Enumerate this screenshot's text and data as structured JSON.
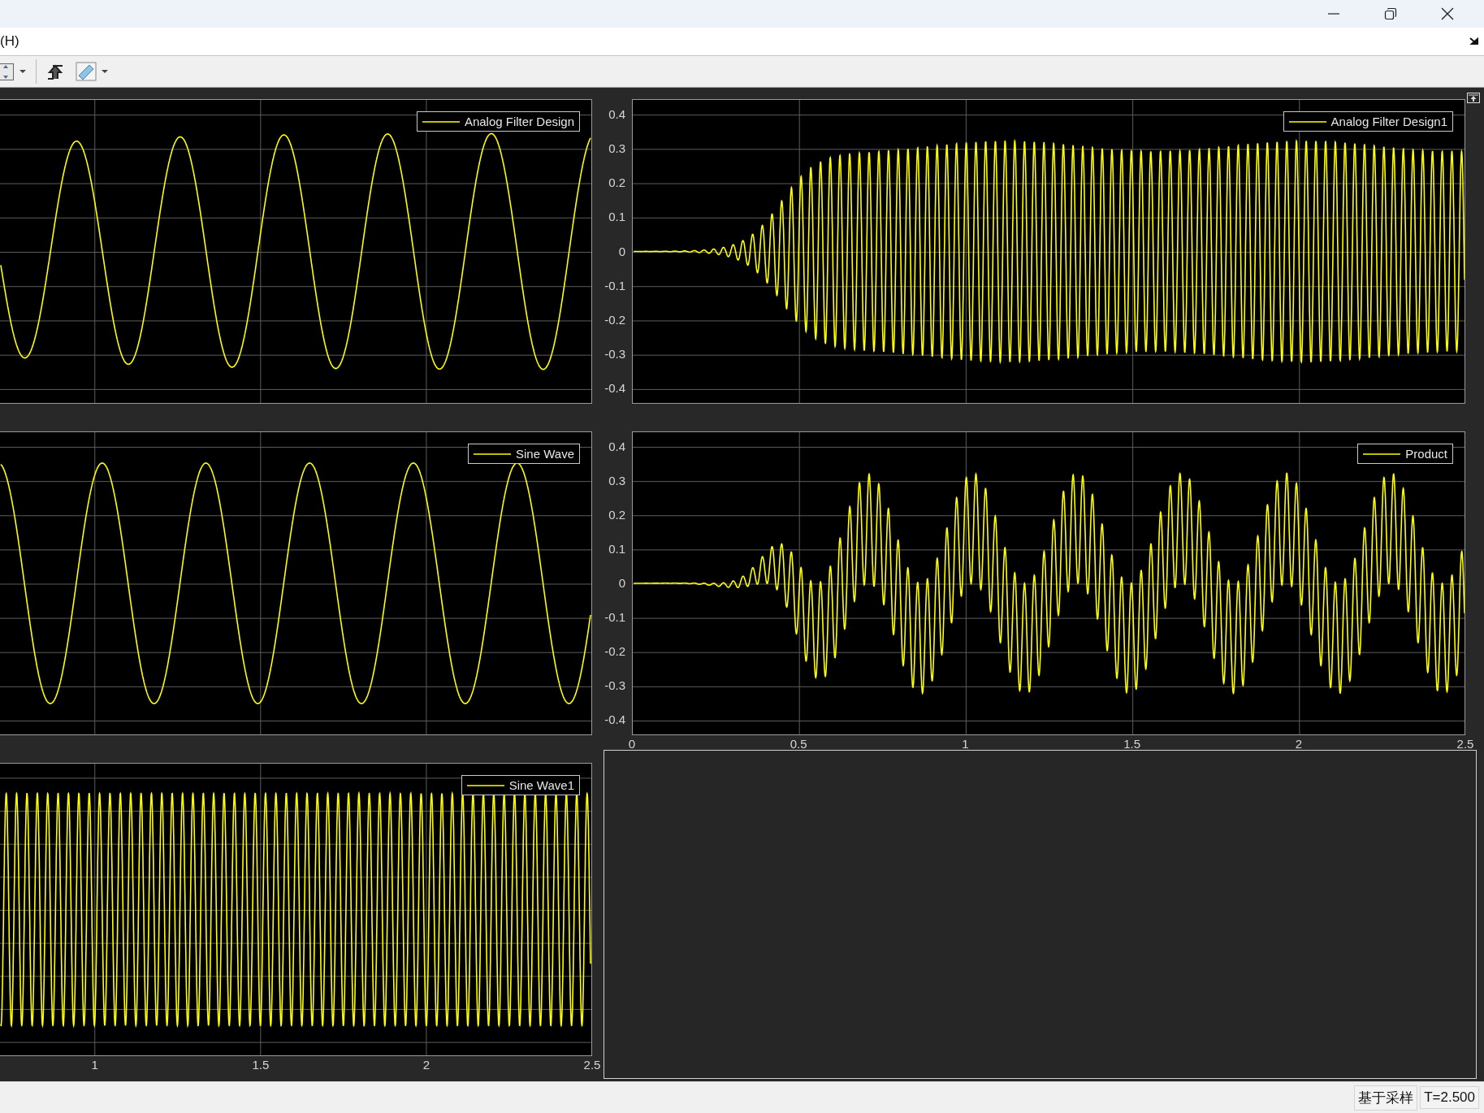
{
  "menu": {
    "items": [
      "(H)"
    ]
  },
  "left_scopes": [
    {
      "legend": "Analog Filter Design",
      "kind": "filtered_sine"
    },
    {
      "legend": "Sine Wave",
      "kind": "sine"
    },
    {
      "legend": "Sine Wave1",
      "kind": "fast_sine",
      "xticks": [
        "1",
        "1.5",
        "2",
        "2.5"
      ]
    }
  ],
  "right_scopes": [
    {
      "legend": "Analog Filter Design1",
      "kind": "filtered_carrier",
      "yticks": [
        "0.4",
        "0.3",
        "0.2",
        "0.1",
        "0",
        "-0.1",
        "-0.2",
        "-0.3",
        "-0.4"
      ]
    },
    {
      "legend": "Product",
      "kind": "product",
      "yticks": [
        "0.4",
        "0.3",
        "0.2",
        "0.1",
        "0",
        "-0.1",
        "-0.2",
        "-0.3",
        "-0.4"
      ],
      "xticks": [
        "0",
        "0.5",
        "1",
        "1.5",
        "2",
        "2.5"
      ]
    }
  ],
  "status_bar": {
    "mode": "基于采样",
    "time": "T=2.500"
  }
}
